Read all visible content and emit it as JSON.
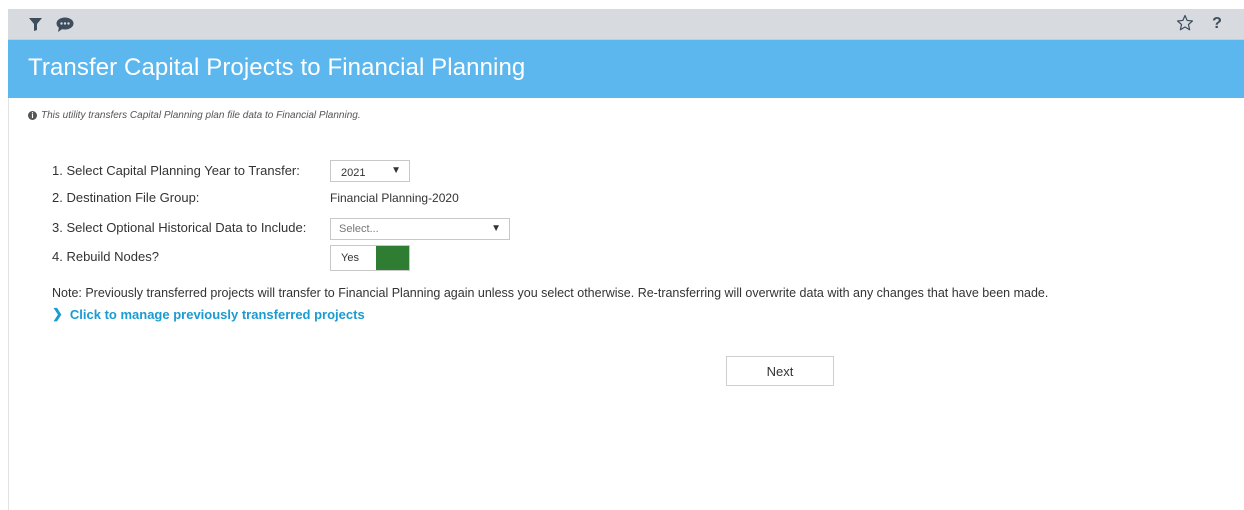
{
  "toolbar": {
    "left_icons": [
      "filter-icon",
      "chat-icon"
    ],
    "right_icons": [
      "star-icon",
      "help-icon"
    ],
    "help_glyph": "?"
  },
  "header": {
    "title": "Transfer Capital Projects to Financial Planning",
    "background": "#5db7ef"
  },
  "info": {
    "icon": "info-icon",
    "text": "This utility transfers Capital Planning plan file data to Financial Planning."
  },
  "form": {
    "step1_label": "1. Select Capital Planning Year to Transfer:",
    "year_value": "2021",
    "step2_label": "2. Destination File Group:",
    "destination_value": "Financial Planning-2020",
    "step3_label": "3. Select Optional Historical Data to Include:",
    "historical_placeholder": "Select...",
    "step4_label": "4. Rebuild Nodes?",
    "rebuild_value": "Yes",
    "toggle_color": "#2e7d32"
  },
  "note": "Note: Previously transferred projects will transfer to Financial Planning again unless you select otherwise. Re-transferring will overwrite data with any changes that have been made.",
  "manage_link": "Click to manage previously transferred projects",
  "next_button": "Next"
}
